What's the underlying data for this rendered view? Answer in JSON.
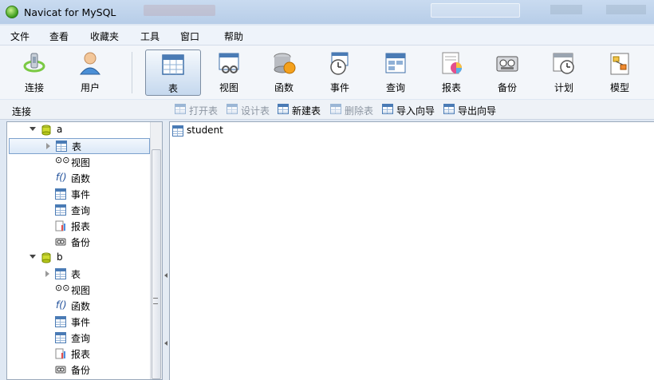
{
  "window": {
    "title": "Navicat for MySQL"
  },
  "menu": [
    "文件",
    "查看",
    "收藏夹",
    "工具",
    "窗口",
    "帮助"
  ],
  "toolbar": {
    "connect": "连接",
    "user": "用户",
    "table": "表",
    "view": "视图",
    "function": "函数",
    "event": "事件",
    "query": "查询",
    "report": "报表",
    "backup": "备份",
    "schedule": "计划",
    "model": "模型"
  },
  "objbar": {
    "panel_title": "连接",
    "open_table": "打开表",
    "design_table": "设计表",
    "new_table": "新建表",
    "delete_table": "删除表",
    "import_wizard": "导入向导",
    "export_wizard": "导出向导"
  },
  "tree": {
    "db_a": {
      "name": "a",
      "items": [
        "表",
        "视图",
        "函数",
        "事件",
        "查询",
        "报表",
        "备份"
      ]
    },
    "db_b": {
      "name": "b",
      "items": [
        "表",
        "视图",
        "函数",
        "事件",
        "查询",
        "报表",
        "备份"
      ]
    }
  },
  "objects": [
    "student"
  ],
  "icons": {
    "table": "table-icon",
    "view": "view-icon",
    "function": "function-icon",
    "event": "event-icon",
    "query": "query-icon",
    "report": "report-icon",
    "backup": "backup-icon",
    "database": "database-icon"
  }
}
